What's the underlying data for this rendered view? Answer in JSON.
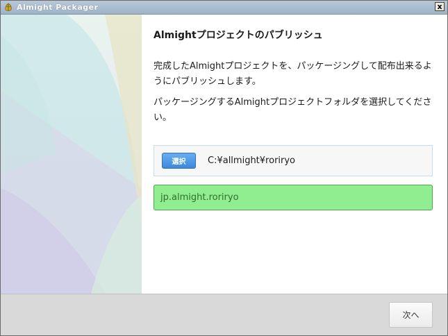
{
  "window": {
    "title": "Almight Packager",
    "close_glyph": "x"
  },
  "icons": {
    "app": "app-leaf-icon",
    "close": "close-icon"
  },
  "wizard": {
    "heading": "Almightプロジェクトのパブリッシュ",
    "description1": "完成したAlmightプロジェクトを、パッケージングして配布出来るようにパブリッシュします。",
    "description2": "パッケージングするAlmightプロジェクトフォルダを選択してください。",
    "select_button_label": "選択",
    "folder_path": "C:¥allmight¥roriryo",
    "package_name": "jp.almight.roriryo"
  },
  "footer": {
    "next_button_label": "次へ"
  },
  "colors": {
    "package_bg": "#90ee90",
    "select_button": "#3d88dd",
    "titlebar": "#9fb3c8"
  }
}
